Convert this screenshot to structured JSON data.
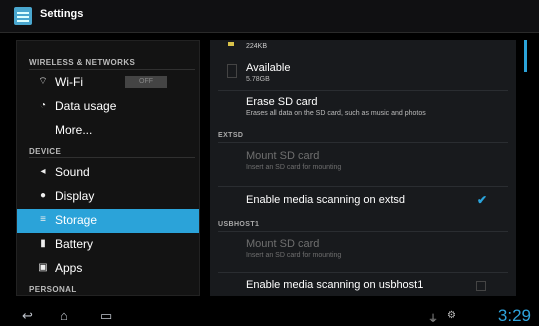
{
  "app": {
    "title": "Settings"
  },
  "sidebar": {
    "sections": {
      "wireless": "WIRELESS & NETWORKS",
      "device": "DEVICE",
      "personal": "PERSONAL"
    },
    "items": [
      {
        "label": "Wi-Fi",
        "icon": "wifi-icon",
        "toggle": "OFF"
      },
      {
        "label": "Data usage",
        "icon": "data-usage-icon"
      },
      {
        "label": "More..."
      },
      {
        "label": "Sound",
        "icon": "sound-icon"
      },
      {
        "label": "Display",
        "icon": "display-icon"
      },
      {
        "label": "Storage",
        "icon": "storage-icon",
        "selected": true
      },
      {
        "label": "Battery",
        "icon": "battery-icon"
      },
      {
        "label": "Apps",
        "icon": "apps-icon"
      }
    ]
  },
  "storage": {
    "top_value": "224KB",
    "available_label": "Available",
    "available_value": "5.78GB",
    "erase_title": "Erase SD card",
    "erase_desc": "Erases all data on the SD card, such as music and photos",
    "extsd_header": "EXTSD",
    "extsd_mount_title": "Mount SD card",
    "extsd_mount_desc": "Insert an SD card for mounting",
    "extsd_scan_title": "Enable media scanning on extsd",
    "usbhost_header": "USBHOST1",
    "usbhost_mount_title": "Mount SD card",
    "usbhost_mount_desc": "Insert an SD card for mounting",
    "usbhost_scan_title": "Enable media scanning on usbhost1"
  },
  "status_bar": {
    "time": "3:29"
  },
  "colors": {
    "accent": "#2ba3d9",
    "background": "#000000",
    "panel": "#181a1d"
  }
}
